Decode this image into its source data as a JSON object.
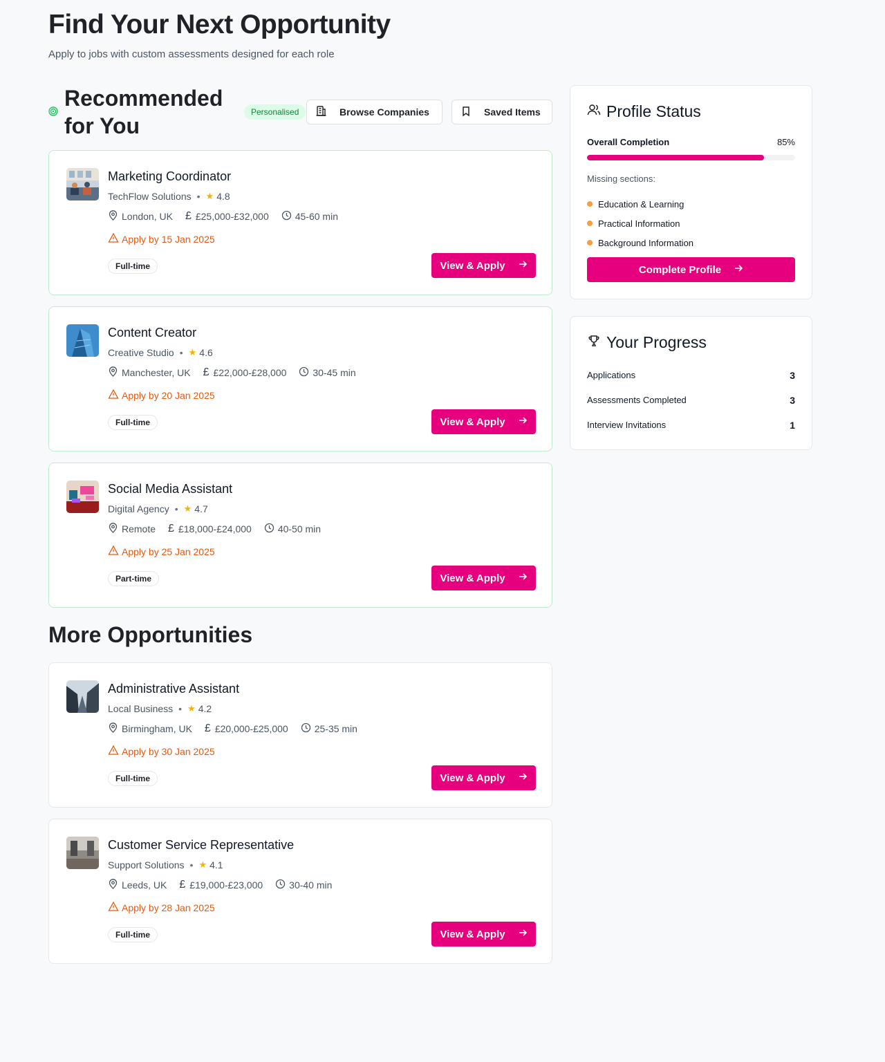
{
  "header": {
    "title": "Find Your Next Opportunity",
    "subtitle": "Apply to jobs with custom assessments designed for each role"
  },
  "recommended": {
    "title": "Recommended for You",
    "badge": "Personalised",
    "browse_label": "Browse Companies",
    "saved_label": "Saved Items"
  },
  "more": {
    "title": "More Opportunities"
  },
  "apply_label": "View & Apply",
  "jobs": [
    {
      "title": "Marketing Coordinator",
      "company": "TechFlow Solutions",
      "rating": "4.8",
      "location": "London, UK",
      "salary": "£25,000-£32,000",
      "duration": "45-60 min",
      "deadline": "Apply by 15 Jan 2025",
      "type": "Full-time",
      "thumb": "office-photo"
    },
    {
      "title": "Content Creator",
      "company": "Creative Studio",
      "rating": "4.6",
      "location": "Manchester, UK",
      "salary": "£22,000-£28,000",
      "duration": "30-45 min",
      "deadline": "Apply by 20 Jan 2025",
      "type": "Full-time",
      "thumb": "glass-building-photo"
    },
    {
      "title": "Social Media Assistant",
      "company": "Digital Agency",
      "rating": "4.7",
      "location": "Remote",
      "salary": "£18,000-£24,000",
      "duration": "40-50 min",
      "deadline": "Apply by 25 Jan 2025",
      "type": "Part-time",
      "thumb": "colorful-office-photo"
    },
    {
      "title": "Administrative Assistant",
      "company": "Local Business",
      "rating": "4.2",
      "location": "Birmingham, UK",
      "salary": "£20,000-£25,000",
      "duration": "25-35 min",
      "deadline": "Apply by 30 Jan 2025",
      "type": "Full-time",
      "thumb": "skyscrapers-photo"
    },
    {
      "title": "Customer Service Representative",
      "company": "Support Solutions",
      "rating": "4.1",
      "location": "Leeds, UK",
      "salary": "£19,000-£23,000",
      "duration": "30-40 min",
      "deadline": "Apply by 28 Jan 2025",
      "type": "Full-time",
      "thumb": "interior-photo"
    }
  ],
  "profile_status": {
    "title": "Profile Status",
    "completion_label": "Overall Completion",
    "completion_value": "85%",
    "completion_fraction": 0.85,
    "missing_label": "Missing sections:",
    "missing": [
      "Education & Learning",
      "Practical Information",
      "Background Information"
    ],
    "button_label": "Complete Profile"
  },
  "progress": {
    "title": "Your Progress",
    "stats": [
      {
        "label": "Applications",
        "value": "3"
      },
      {
        "label": "Assessments Completed",
        "value": "3"
      },
      {
        "label": "Interview Invitations",
        "value": "1"
      }
    ]
  },
  "colors": {
    "accent": "#e6007e",
    "warning": "#ea580c",
    "badge_green": "#15803d",
    "star": "#f5b301",
    "missing_dot": "#f59e42"
  }
}
